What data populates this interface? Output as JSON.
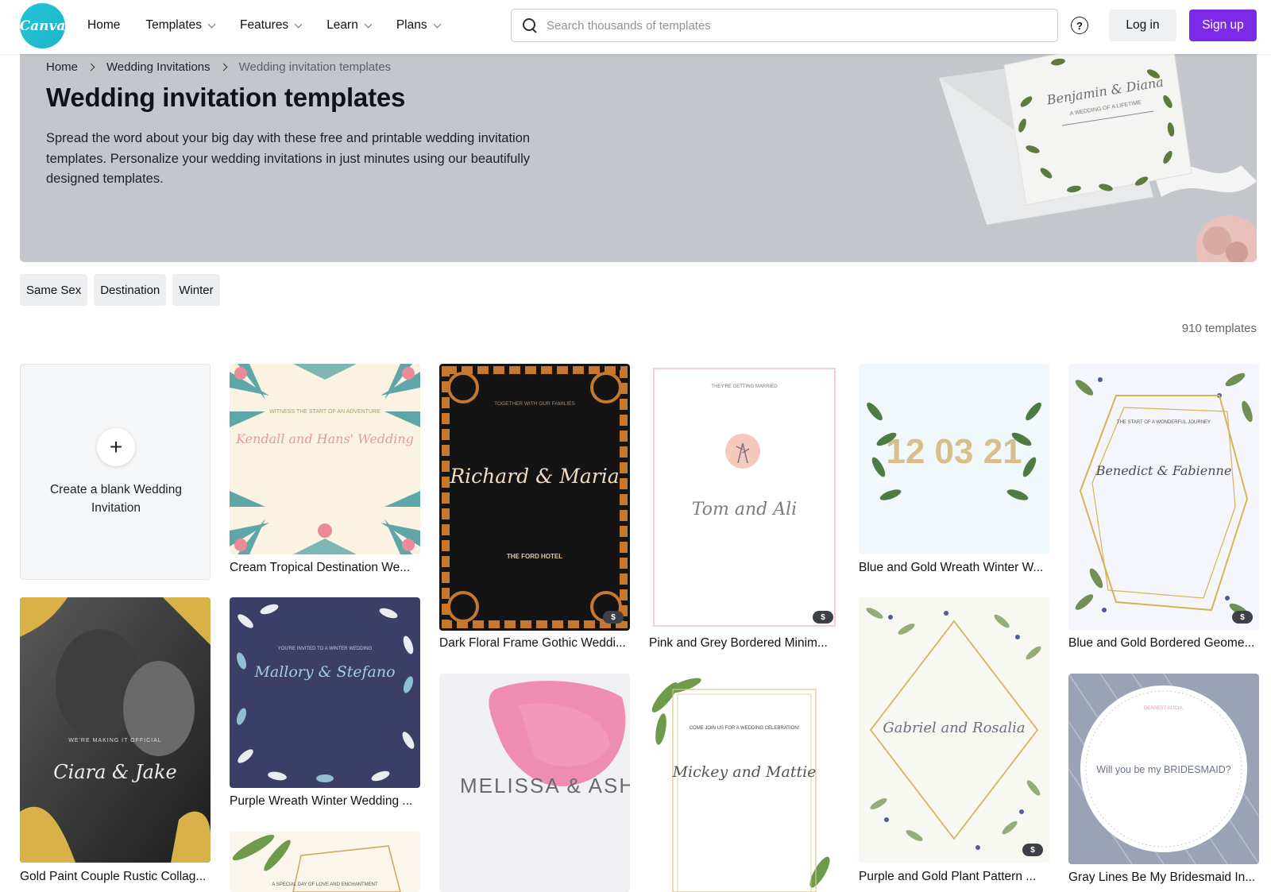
{
  "brand": {
    "logo_text": "Canva",
    "accent": "#7d2ae8",
    "logo_color": "#23c4d8"
  },
  "nav": {
    "items": [
      {
        "label": "Home",
        "has_dropdown": false
      },
      {
        "label": "Templates",
        "has_dropdown": true
      },
      {
        "label": "Features",
        "has_dropdown": true
      },
      {
        "label": "Learn",
        "has_dropdown": true
      },
      {
        "label": "Plans",
        "has_dropdown": true
      }
    ],
    "search_placeholder": "Search thousands of templates",
    "help_icon": "?",
    "login_label": "Log in",
    "signup_label": "Sign up"
  },
  "breadcrumb": [
    "Home",
    "Wedding Invitations",
    "Wedding invitation templates"
  ],
  "hero": {
    "title": "Wedding invitation templates",
    "description": "Spread the word about your big day with these free and printable wedding invitation templates. Personalize your wedding invitations in just minutes using our beautifully designed templates.",
    "card_names": "Benjamin & Diana",
    "card_sub": "A WEDDING OF A LIFETIME"
  },
  "filters": [
    "Same Sex",
    "Destination",
    "Winter"
  ],
  "count_label": "910 templates",
  "blank_card": {
    "icon": "+",
    "label": "Create a blank Wedding Invitation"
  },
  "templates": [
    {
      "title": "Cream Tropical Destination We...",
      "text_top": "WITNESS THE START OF AN ADVENTURE",
      "text_main": "Kendall and Hans' Wedding",
      "pro": false
    },
    {
      "title": "Dark Floral Frame Gothic Weddi...",
      "text_top": "TOGETHER WITH OUR FAMILIES",
      "text_main": "Richard & Maria",
      "text_bottom": "THE FORD HOTEL",
      "pro": true
    },
    {
      "title": "Pink and Grey Bordered Minim...",
      "text_top": "THEY'RE GETTING MARRIED",
      "text_main": "Tom and Ali",
      "pro": true
    },
    {
      "title": "Blue and Gold Wreath Winter W...",
      "text_main": "12 03 21",
      "pro": false
    },
    {
      "title": "Blue and Gold Bordered Geome...",
      "text_top": "THE START OF A WONDERFUL JOURNEY",
      "text_main": "Benedict & Fabienne",
      "pro": true
    },
    {
      "title": "Gold Paint Couple Rustic Collag...",
      "text_top": "WE'RE MAKING IT OFFICIAL",
      "text_main": "Ciara & Jake",
      "pro": false
    },
    {
      "title": "Purple Wreath Winter Wedding ...",
      "text_top": "YOU'RE INVITED TO A WINTER WEDDING",
      "text_main": "Mallory & Stefano",
      "pro": false
    },
    {
      "title": "",
      "text_main": "MELISSA & ASHLEY",
      "pro": false
    },
    {
      "title": "",
      "text_top": "COME JOIN US FOR A WEDDING CELEBRATION!",
      "text_main": "Mickey and Mattie",
      "pro": false
    },
    {
      "title": "Purple and Gold Plant Pattern ...",
      "text_main": "Gabriel and Rosalia",
      "pro": true
    },
    {
      "title": "Gray Lines Be My Bridesmaid In...",
      "text_top": "DEAREST ALICIA,",
      "text_main": "Will you be my BRIDESMAID?",
      "pro": false
    },
    {
      "title": "",
      "text_top": "A SPECIAL DAY OF LOVE AND ENCHANTMENT",
      "pro": false
    }
  ],
  "badge_label": "$"
}
